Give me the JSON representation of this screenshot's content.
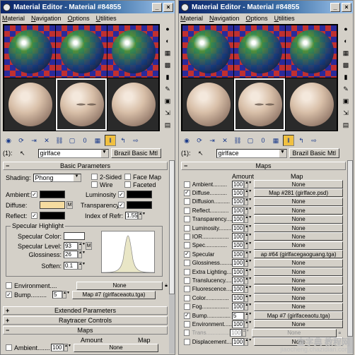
{
  "window_title": "Material Editor - Material #84855",
  "menu": [
    "Material",
    "Navigation",
    "Options",
    "Utilities"
  ],
  "slot_index": "(1):",
  "material_name": "girlface",
  "material_type": "Brazil Basic Mtl",
  "left_panel": {
    "basic_parameters_title": "Basic Parameters",
    "shading_label": "Shading:",
    "shading_value": "Phong",
    "two_sided": "2-Sided",
    "wire": "Wire",
    "face_map": "Face Map",
    "faceted": "Faceted",
    "ambient_label": "Ambient:",
    "diffuse_label": "Diffuse:",
    "reflect_label": "Reflect:",
    "luminosity_label": "Luminosity",
    "transparency_label": "Transparency:",
    "ior_label": "Index of Refr:",
    "ior_value": "1.55",
    "m": "M",
    "specular_highlight_title": "Specular Highlight",
    "specular_color_label": "Specular Color:",
    "specular_level_label": "Specular Level:",
    "specular_level_value": "93",
    "glossiness_label": "Glossiness:",
    "glossiness_value": "26",
    "soften_label": "Soften:",
    "soften_value": "0.1",
    "environment_label": "Environment....",
    "environment_map": "None",
    "bump_label": "Bump.........",
    "bump_amount": "5",
    "bump_map": "Map #7 (girlfaceaotu.tga)",
    "extended_parameters": "Extended Parameters",
    "raytracer_controls": "Raytracer Controls",
    "maps_title": "Maps",
    "amount_header": "Amount",
    "map_header": "Map",
    "ambient_map_label": "Ambient.......",
    "ambient_map_amount": "100",
    "ambient_map_value": "None"
  },
  "right_panel": {
    "maps_title": "Maps",
    "amount_header": "Amount",
    "map_header": "Map",
    "rows": [
      {
        "label": "Ambient.........",
        "amount": "100",
        "map": "None",
        "checked": false,
        "dim": false
      },
      {
        "label": "Diffuse...........",
        "amount": "100",
        "map": "Map #281 (girlface.psd)",
        "checked": true,
        "dim": false
      },
      {
        "label": "Diffusion..........",
        "amount": "100",
        "map": "None",
        "checked": false,
        "dim": false
      },
      {
        "label": "Reflect............",
        "amount": "100",
        "map": "None",
        "checked": false,
        "dim": false
      },
      {
        "label": "Transparency.....",
        "amount": "100",
        "map": "None",
        "checked": false,
        "dim": false
      },
      {
        "label": "Luminosity.........",
        "amount": "100",
        "map": "None",
        "checked": false,
        "dim": false
      },
      {
        "label": "IOR.................",
        "amount": "100",
        "map": "None",
        "checked": false,
        "dim": false
      },
      {
        "label": "Spec..............",
        "amount": "100",
        "map": "None",
        "checked": false,
        "dim": false
      },
      {
        "label": "Specular",
        "amount": "100",
        "map": "ap #64 (girlfacegaoguang.tga)",
        "checked": true,
        "dim": false
      },
      {
        "label": "Glossiness.........",
        "amount": "100",
        "map": "None",
        "checked": false,
        "dim": false
      },
      {
        "label": "Extra Lighting......",
        "amount": "100",
        "map": "None",
        "checked": false,
        "dim": false
      },
      {
        "label": "Translucency.......",
        "amount": "100",
        "map": "None",
        "checked": false,
        "dim": false
      },
      {
        "label": "Fluorescence.......",
        "amount": "100",
        "map": "None",
        "checked": false,
        "dim": false
      },
      {
        "label": "Color...............",
        "amount": "100",
        "map": "None",
        "checked": false,
        "dim": false
      },
      {
        "label": "Fog.................",
        "amount": "100",
        "map": "None",
        "checked": false,
        "dim": false
      },
      {
        "label": "Bump...............",
        "amount": "5",
        "map": "Map #7 (girlfaceaotu.tga)",
        "checked": true,
        "dim": false
      },
      {
        "label": "Environment.......",
        "amount": "100",
        "map": "None",
        "checked": false,
        "dim": false
      },
      {
        "label": "Trans...............",
        "amount": "100",
        "map": "None",
        "checked": false,
        "dim": true
      },
      {
        "label": "Displacement.......",
        "amount": "100",
        "map": "None",
        "checked": false,
        "dim": false
      }
    ]
  },
  "watermark": {
    "line1": "查字典 教程网",
    "line2": "jiaocheng.chazidian.com"
  },
  "colors": {
    "title_start": "#0a246a",
    "title_end": "#a6caf0",
    "diffuse_swatch": "#f5dca0",
    "ui_face": "#d4d0c8"
  }
}
